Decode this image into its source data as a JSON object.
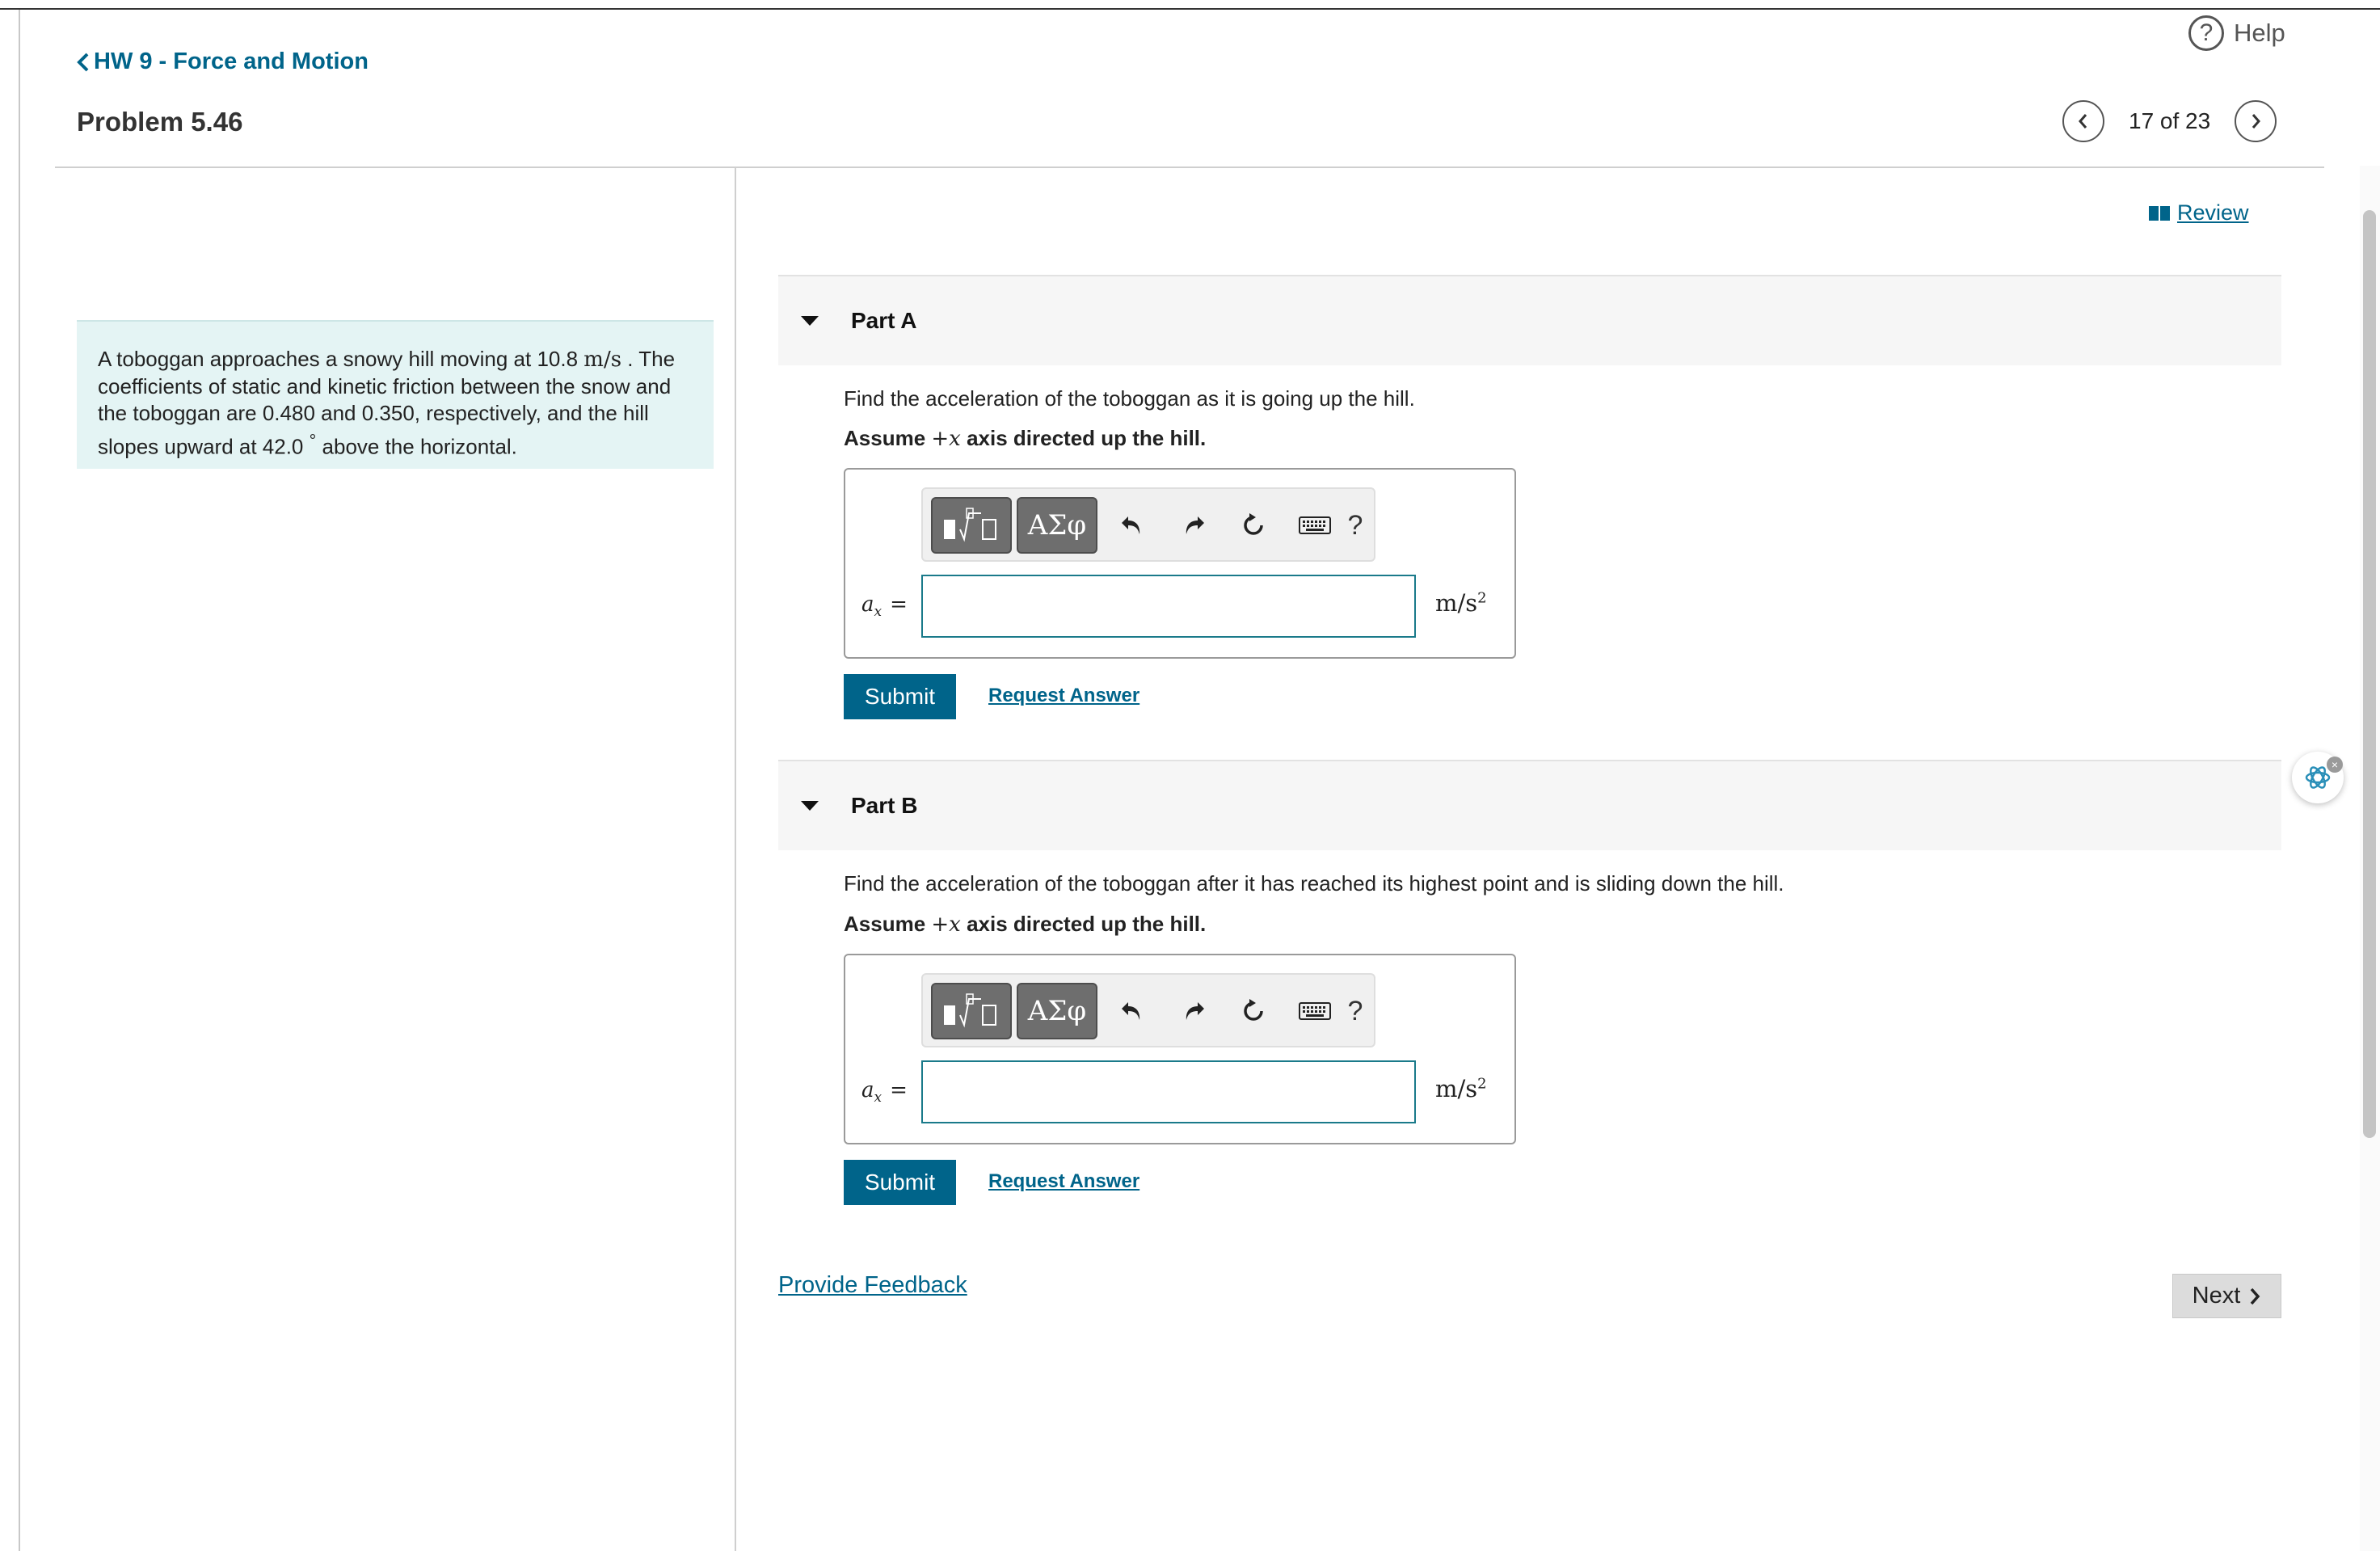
{
  "help": {
    "label": "Help",
    "icon": "question-circle-icon"
  },
  "header": {
    "back_link": "HW 9 - Force and Motion",
    "problem_title": "Problem 5.46",
    "pager_text": "17 of 23"
  },
  "statement": {
    "part1": "A toboggan approaches a snowy hill moving at 10.8 ",
    "speed_unit": "m/s",
    "part2": " . The coefficients of static and kinetic friction between the snow and the toboggan are 0.480 and 0.350, respectively, and the hill slopes upward at 42.0 ",
    "degree": "°",
    "part3": " above the horizontal."
  },
  "review": {
    "label": "Review",
    "icon": "book-icon"
  },
  "parts": [
    {
      "title": "Part A",
      "question": "Find the acceleration of the toboggan as it is going up the hill.",
      "assume_pre": "Assume ",
      "assume_math": "+x",
      "assume_post": " axis directed up the hill.",
      "toolbar": {
        "greek_label": "ΑΣφ",
        "help_label": "?"
      },
      "var_base": "a",
      "var_sub": "x",
      "equals": "=",
      "input_value": "",
      "unit_base": "m/s",
      "unit_exp": "2",
      "submit_label": "Submit",
      "request_label": "Request Answer"
    },
    {
      "title": "Part B",
      "question": "Find the acceleration of the toboggan after it has reached its highest point and is sliding down the hill.",
      "assume_pre": "Assume ",
      "assume_math": "+x",
      "assume_post": " axis directed up the hill.",
      "toolbar": {
        "greek_label": "ΑΣφ",
        "help_label": "?"
      },
      "var_base": "a",
      "var_sub": "x",
      "equals": "=",
      "input_value": "",
      "unit_base": "m/s",
      "unit_exp": "2",
      "submit_label": "Submit",
      "request_label": "Request Answer"
    }
  ],
  "footer": {
    "feedback_label": "Provide Feedback",
    "next_label": "Next"
  },
  "colors": {
    "link": "#00648a",
    "submit_bg": "#00648a",
    "statement_bg": "#e4f4f4"
  }
}
